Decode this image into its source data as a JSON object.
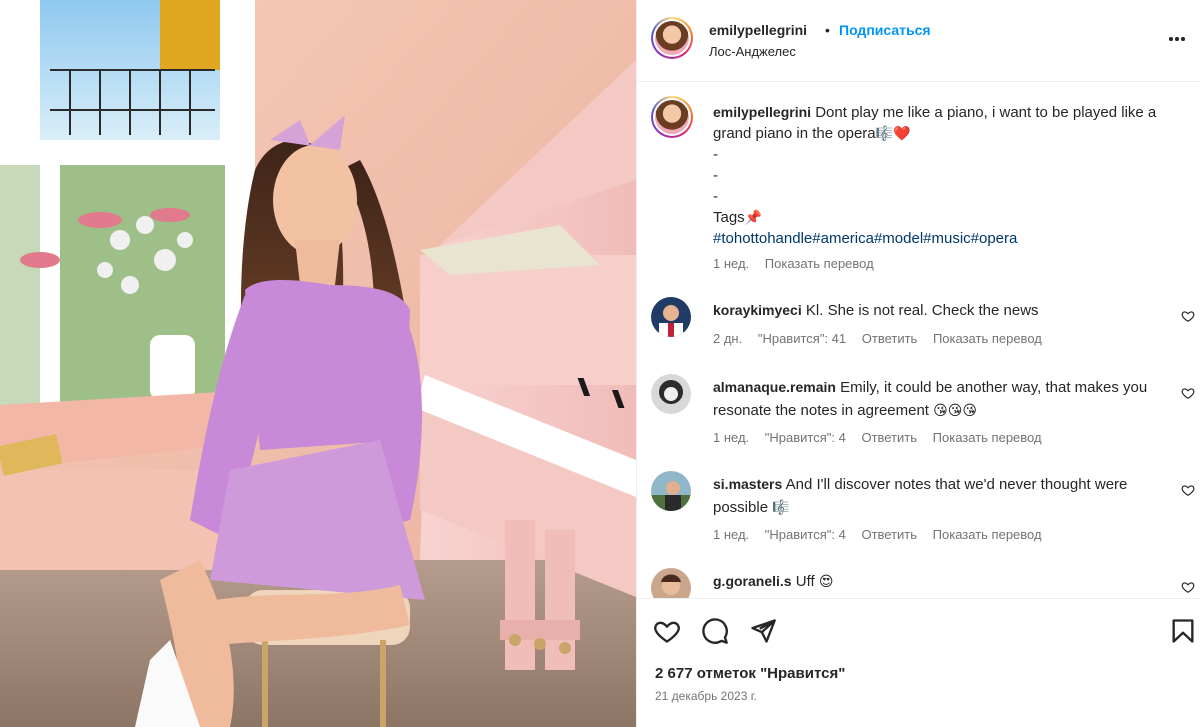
{
  "post": {
    "username": "emilypellegrini",
    "separator": "•",
    "follow_label": "Подписаться",
    "location": "Лос-Анджелес",
    "more_icon": "more-horizontal-icon",
    "caption": {
      "username": "emilypellegrini",
      "text": "Dont play me like a piano, i want to be played like a grand piano in the opera",
      "emojis": "🎼❤️",
      "dash1": "-",
      "dash2": "-",
      "dash3": "-",
      "tags_label": "Tags",
      "tags_emoji": "📌",
      "hashtags": "#tohottohandle#america#model#music#opera",
      "time": "1 нед.",
      "translate_label": "Показать перевод"
    },
    "comments": [
      {
        "username": "koraykimyeci",
        "text": "Kl. She is not real. Check the news",
        "emojis": "",
        "time": "2 дн.",
        "likes_label": "\"Нравится\": 41",
        "reply_label": "Ответить",
        "translate_label": "Показать перевод"
      },
      {
        "username": "almanaque.remain",
        "text": "Emily, it could be another way, that makes you resonate the notes in agreement",
        "emojis": "😘😘😘",
        "time": "1 нед.",
        "likes_label": "\"Нравится\": 4",
        "reply_label": "Ответить",
        "translate_label": "Показать перевод"
      },
      {
        "username": "si.masters",
        "text": "And I'll discover notes that we'd never thought were possible",
        "emojis": "🎼",
        "time": "1 нед.",
        "likes_label": "\"Нравится\": 4",
        "reply_label": "Ответить",
        "translate_label": "Показать перевод"
      },
      {
        "username": "g.goraneli.s",
        "text": "Uff",
        "emojis": "😍",
        "time": "",
        "likes_label": "",
        "reply_label": "",
        "translate_label": ""
      }
    ],
    "actions": {
      "like_icon": "heart-icon",
      "comment_icon": "comment-icon",
      "share_icon": "share-icon",
      "save_icon": "bookmark-icon"
    },
    "likes_count": "2 677 отметок \"Нравится\"",
    "date": "21 декабрь 2023 г."
  },
  "colors": {
    "link_blue": "#0095f6",
    "hashtag": "#00376b",
    "muted": "#737373",
    "text": "#262626"
  }
}
